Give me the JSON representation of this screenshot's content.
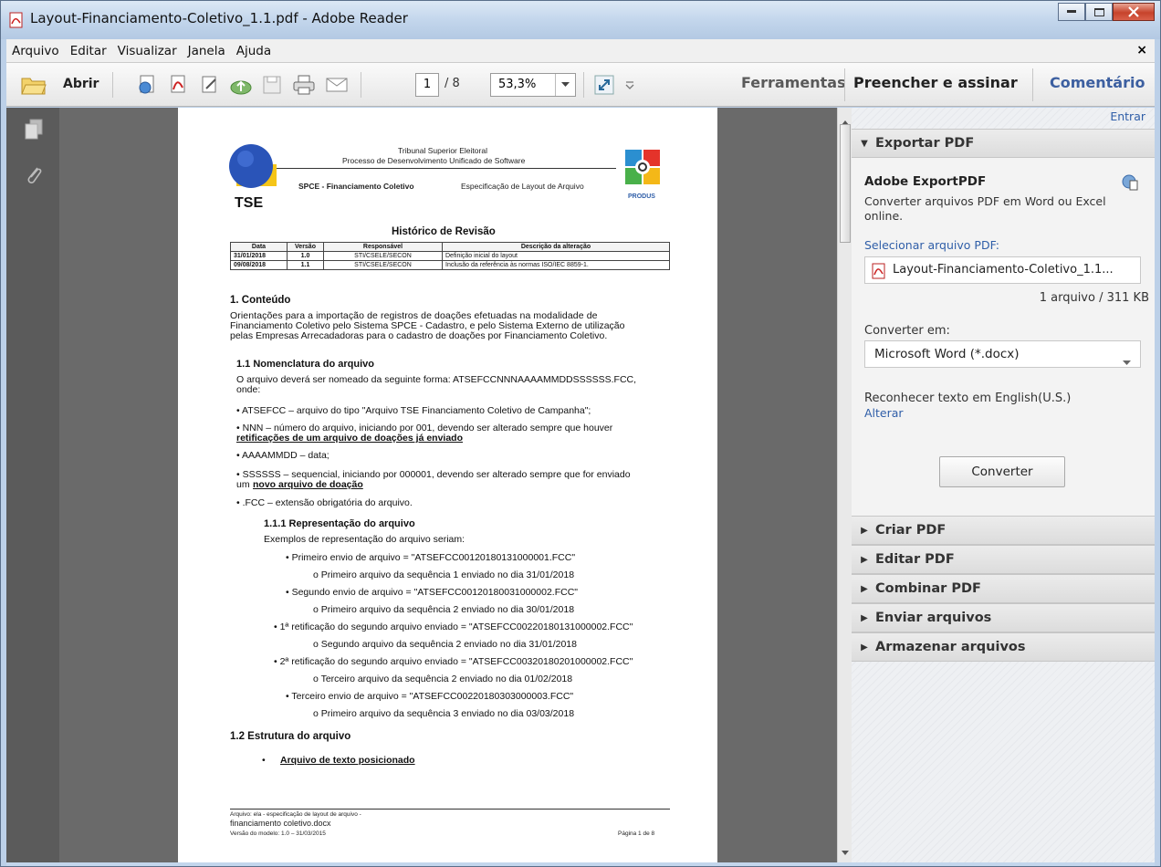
{
  "window": {
    "title": "Layout-Financiamento-Coletivo_1.1.pdf - Adobe Reader"
  },
  "menu": {
    "items": [
      "Arquivo",
      "Editar",
      "Visualizar",
      "Janela",
      "Ajuda"
    ],
    "close": "×"
  },
  "toolbar": {
    "open_label": "Abrir",
    "page_current": "1",
    "page_total": "/ 8",
    "zoom": "53,3%",
    "tabs": {
      "tools": "Ferramentas",
      "fill_sign": "Preencher e assinar",
      "comment": "Comentário"
    }
  },
  "document": {
    "org": "Tribunal Superior Eleitoral",
    "process": "Processo de Desenvolvimento Unificado de Software",
    "logo_left": "TSE",
    "logo_right": "PRODUS",
    "system": "SPCE - Financiamento Coletivo",
    "spec": "Especificação de Layout de Arquivo",
    "revision_title": "Histórico de Revisão",
    "revision_headers": [
      "Data",
      "Versão",
      "Responsável",
      "Descrição da alteração"
    ],
    "revision_rows": [
      [
        "31/01/2018",
        "1.0",
        "STI/CSELE/SECON",
        "Definição inicial do layout"
      ],
      [
        "09/08/2018",
        "1.1",
        "STI/CSELE/SECON",
        "Inclusão da referência às normas ISO/IEC 8859-1."
      ]
    ],
    "h_conteudo": "1. Conteúdo",
    "p_conteudo": [
      "Orientações para a importação de registros de doações efetuadas na modalidade de",
      "Financiamento Coletivo pelo Sistema SPCE - Cadastro, e pelo Sistema Externo de utilização",
      "pelas Empresas Arrecadadoras para o cadastro de doações por Financiamento Coletivo."
    ],
    "h_nomenclatura": "1.1 Nomenclatura do arquivo",
    "p_nomenclatura": [
      "O arquivo deverá ser nomeado da seguinte forma: ATSEFCCNNNAAAAMMDDSSSSSS.FCC,",
      "onde:"
    ],
    "bullet1": "•  ATSEFCC – arquivo do tipo \"Arquivo TSE Financiamento Coletivo de Campanha\";",
    "bullet2a": "•  NNN – número do arquivo, iniciando por 001, devendo ser alterado sempre que houver",
    "bullet2b": "retificações de um arquivo de doações já enviado",
    "bullet3": "•  AAAAMMDD – data;",
    "bullet4a": "•  SSSSSS – sequencial, iniciando por 000001, devendo ser alterado sempre que for enviado",
    "bullet4b_pre": "um ",
    "bullet4b": "novo arquivo de doação",
    "bullet5": "•  .FCC – extensão obrigatória do arquivo.",
    "h_repr": "1.1.1  Representação do arquivo",
    "p_repr": "Exemplos de representação do arquivo seriam:",
    "examples": [
      "•  Primeiro envio de arquivo = \"ATSEFCC00120180131000001.FCC\"",
      "o   Primeiro arquivo da sequência 1 enviado no dia 31/01/2018",
      "•  Segundo envio de arquivo = \"ATSEFCC00120180031000002.FCC\"",
      "o   Primeiro arquivo da sequência 2 enviado no dia 30/01/2018",
      "•  1ª retificação do segundo arquivo enviado = \"ATSEFCC00220180131000002.FCC\"",
      "o   Segundo arquivo da sequência 2 enviado no dia 31/01/2018",
      "•  2ª retificação do segundo arquivo enviado = \"ATSEFCC00320180201000002.FCC\"",
      "o   Terceiro arquivo da sequência 2 enviado no dia 01/02/2018",
      "•  Terceiro envio de arquivo = \"ATSEFCC00220180303000003.FCC\"",
      "o   Primeiro arquivo da sequência 3 enviado no dia 03/03/2018"
    ],
    "h_estrutura": "1.2  Estrutura do arquivo",
    "bullet_texto": "Arquivo de texto posicionado",
    "footer_l1": "Arquivo: ela - especificação de layout de arquivo -",
    "footer_l2": "financiamento coletivo.docx",
    "footer_l3": "Versão do modelo: 1.0 – 31/03/2015",
    "footer_page": "Página 1 de 8"
  },
  "panel": {
    "signin": "Entrar",
    "export_header": "Exportar PDF",
    "export_title": "Adobe ExportPDF",
    "export_desc": "Converter arquivos PDF em Word ou Excel online.",
    "select_file": "Selecionar arquivo PDF:",
    "file_name": "Layout-Financiamento-Coletivo_1.1...",
    "file_count": "1 arquivo / 311 KB",
    "convert_to": "Converter em:",
    "convert_format": "Microsoft Word (*.docx)",
    "ocr_lang": "Reconhecer texto em English(U.S.)",
    "change": "Alterar",
    "convert_btn": "Converter",
    "sections": [
      "Criar PDF",
      "Editar PDF",
      "Combinar PDF",
      "Enviar arquivos",
      "Armazenar arquivos"
    ]
  },
  "colors": {
    "link": "#2f5ea8",
    "toolbar_bg": "#e6e6e6",
    "doc_bg": "#6a6a6a"
  }
}
